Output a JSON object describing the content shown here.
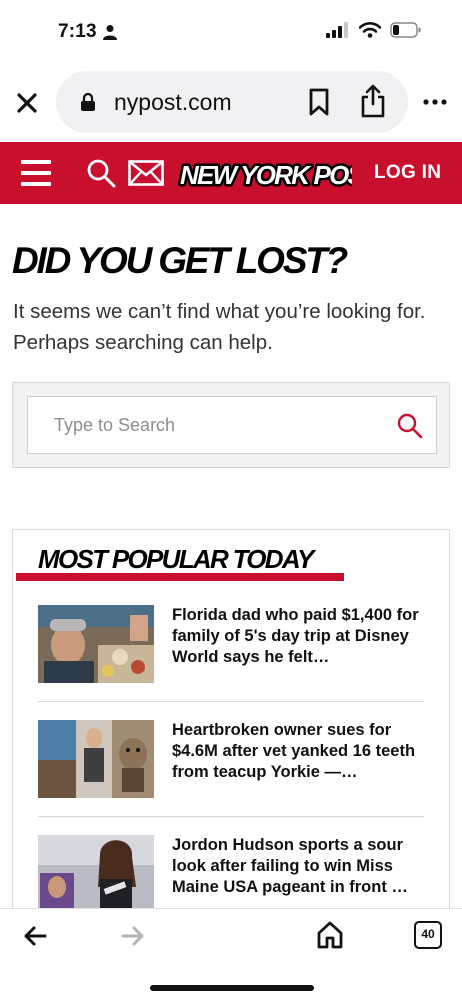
{
  "status_bar": {
    "time": "7:13"
  },
  "browser": {
    "url": "nypost.com"
  },
  "header": {
    "logo_text": "NEW YORK POST",
    "login_label": "LOG IN"
  },
  "main": {
    "headline": "DID YOU GET LOST?",
    "subtext": "It seems we can’t find what you’re looking for. Perhaps searching can help.",
    "search_placeholder": "Type to Search"
  },
  "popular": {
    "title": "MOST POPULAR TODAY",
    "stories": [
      {
        "headline": "Florida dad who paid $1,400 for family of 5's day trip at Disney World says he felt…"
      },
      {
        "headline": "Heartbroken owner sues for $4.6M after vet yanked 16 teeth from teacup Yorkie —…"
      },
      {
        "headline": "Jordon Hudson sports a sour look after failing to win Miss Maine USA pageant in front …"
      }
    ]
  },
  "toolbar": {
    "tab_count": "40"
  },
  "colors": {
    "brand_red": "#c8102e"
  }
}
